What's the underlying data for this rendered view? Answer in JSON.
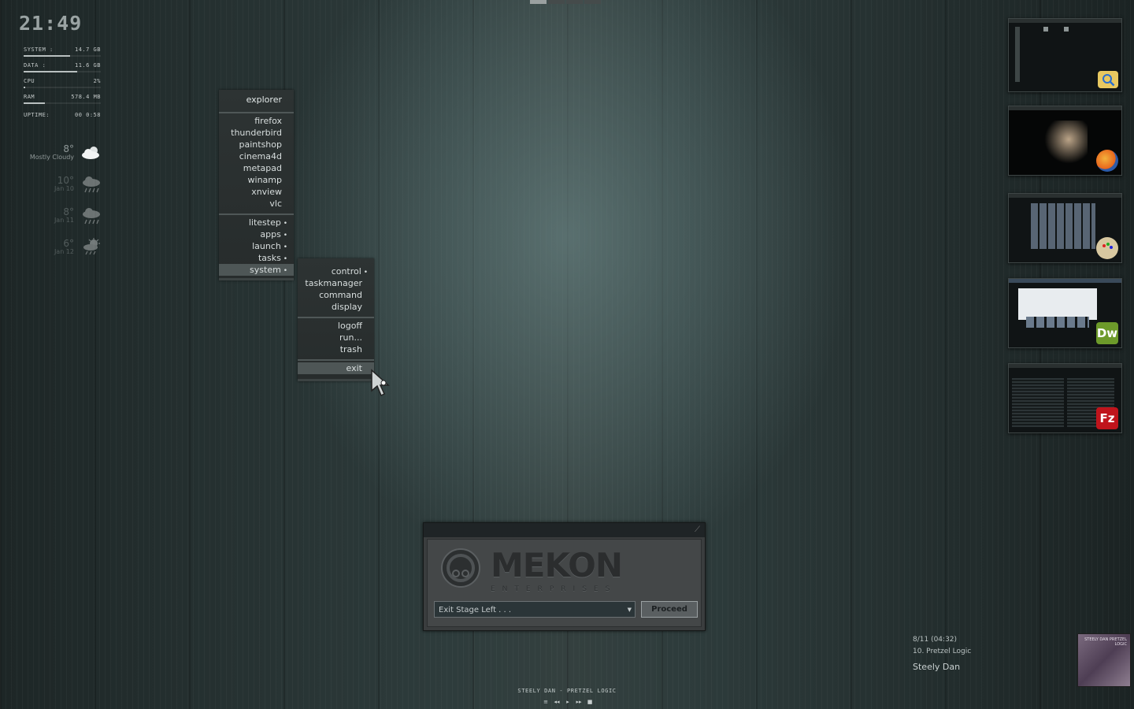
{
  "clock": "21:49",
  "stats": [
    {
      "label": "SYSTEM :",
      "value": "14.7 GB",
      "level": 0.6
    },
    {
      "label": "DATA :",
      "value": "11.6 GB",
      "level": 0.69
    },
    {
      "label": "CPU",
      "value": "2%",
      "level": 0.02
    },
    {
      "label": "RAM",
      "value": "578.4 MB",
      "level": 0.28
    }
  ],
  "uptime": {
    "label": "UPTIME:",
    "value": "00 0:58"
  },
  "weather": [
    {
      "temp": "8°",
      "cond": "Mostly Cloudy",
      "icon": "cloud-sun-icon"
    },
    {
      "temp": "10°",
      "cond": "Jan 10",
      "icon": "rain-cloud-icon"
    },
    {
      "temp": "8°",
      "cond": "Jan 11",
      "icon": "rain-cloud-icon"
    },
    {
      "temp": "6°",
      "cond": "Jan 12",
      "icon": "sun-rain-icon"
    }
  ],
  "menu": {
    "title": "explorer",
    "apps": [
      "firefox",
      "thunderbird",
      "paintshop",
      "cinema4d",
      "metapad",
      "winamp",
      "xnview",
      "vlc"
    ],
    "groups": [
      "litestep",
      "apps",
      "launch",
      "tasks",
      "system"
    ],
    "highlighted": "system"
  },
  "submenu": {
    "items": [
      "control",
      "taskmanager",
      "command",
      "display"
    ],
    "session": [
      "logoff",
      "run...",
      "trash"
    ],
    "exit": "exit"
  },
  "thumbnails": [
    {
      "app": "explorer",
      "icon": "folder-search-icon",
      "color": "#e8c860"
    },
    {
      "app": "firefox",
      "icon": "firefox-icon",
      "color": "#e8661c"
    },
    {
      "app": "paintshop",
      "icon": "paint-palette-icon",
      "color": "#d8c8a0"
    },
    {
      "app": "dreamweaver",
      "icon": "dw-icon",
      "label": "Dw",
      "color": "#6d9a2a"
    },
    {
      "app": "filezilla",
      "icon": "filezilla-icon",
      "label": "Fz",
      "color": "#c0141c"
    }
  ],
  "dialog": {
    "logo_text": "MEKON",
    "logo_sub": "ENTERPRISES",
    "select_value": "Exit Stage Left . . .",
    "button": "Proceed"
  },
  "now_playing": {
    "position": "8/11 (04:32)",
    "track": "10. Pretzel Logic",
    "artist": "Steely Dan",
    "cover_text": "STEELY DAN PRETZEL LOGIC"
  },
  "ticker": "STEELY DAN - PRETZEL LOGIC",
  "controls": [
    "≡",
    "◂◂",
    "▸",
    "▸▸",
    "■"
  ]
}
